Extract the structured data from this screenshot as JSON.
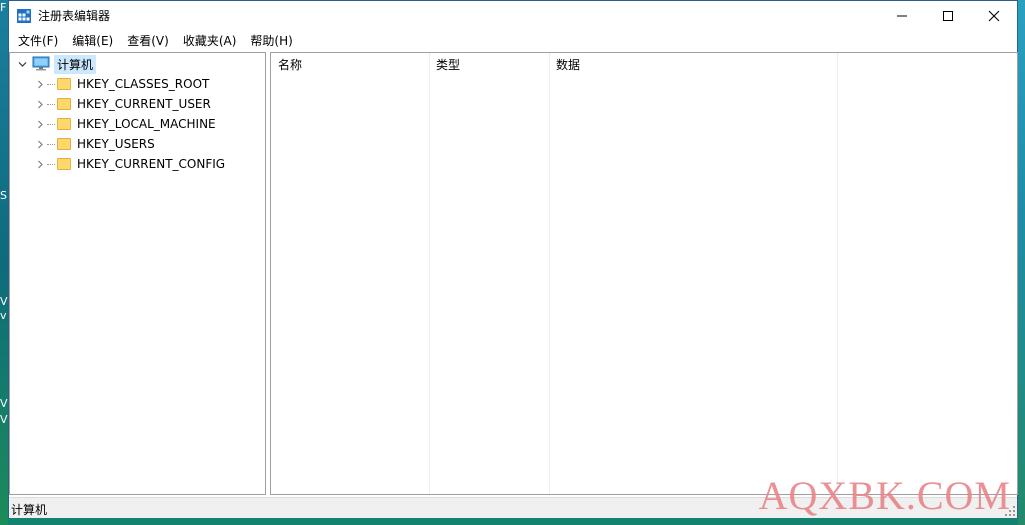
{
  "window": {
    "title": "注册表编辑器"
  },
  "menu": [
    "文件(F)",
    "编辑(E)",
    "查看(V)",
    "收藏夹(A)",
    "帮助(H)"
  ],
  "tree": {
    "root": "计算机",
    "children": [
      "HKEY_CLASSES_ROOT",
      "HKEY_CURRENT_USER",
      "HKEY_LOCAL_MACHINE",
      "HKEY_USERS",
      "HKEY_CURRENT_CONFIG"
    ]
  },
  "columns": [
    "名称",
    "类型",
    "数据"
  ],
  "status": "计算机",
  "watermark": "AQXBK.COM",
  "desktop_glyphs": [
    "F",
    "S",
    "V",
    "v",
    "V",
    "V"
  ],
  "icons": {
    "app": "registry-editor-icon",
    "computer": "computer-icon",
    "folder": "folder-icon"
  },
  "colors": {
    "selection": "#cce8ff",
    "folder": "#ffd86b",
    "watermark": "#e9858a"
  }
}
